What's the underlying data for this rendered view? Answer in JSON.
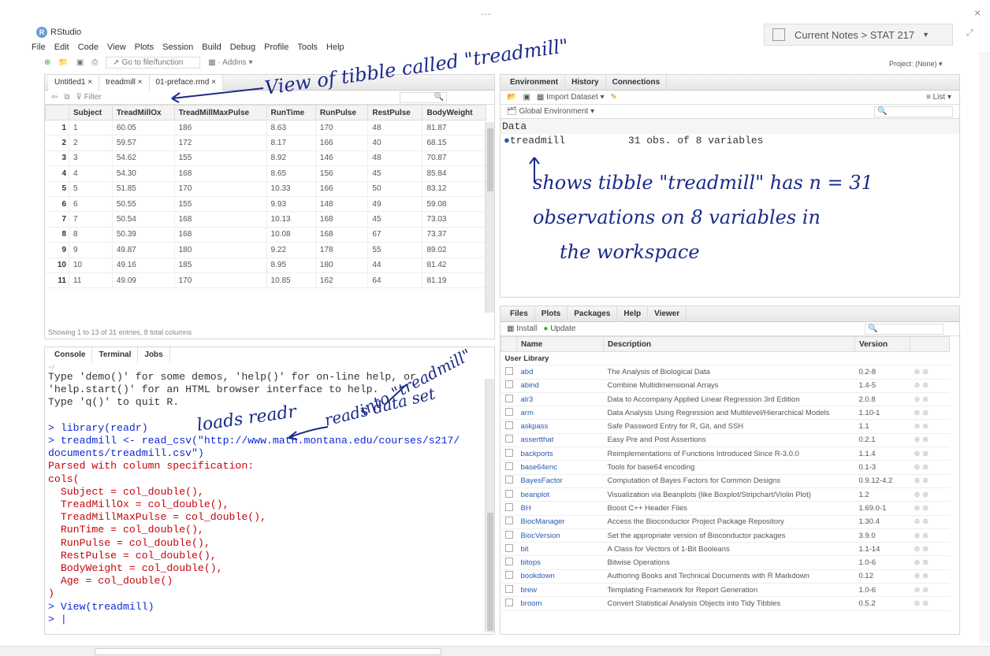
{
  "window": {
    "dots": "···",
    "close": "×",
    "title": "RStudio"
  },
  "menu": [
    "File",
    "Edit",
    "Code",
    "View",
    "Plots",
    "Session",
    "Build",
    "Debug",
    "Profile",
    "Tools",
    "Help"
  ],
  "notes": {
    "text": "Current Notes > STAT 217"
  },
  "toolbar": {
    "goto": "Go to file/function",
    "addins": "Addins",
    "project": "Project: (None)"
  },
  "source": {
    "tabs": [
      "Untitled1",
      "treadmill",
      "01-preface.rmd"
    ],
    "filter": "Filter",
    "columns": [
      "",
      "Subject",
      "TreadMillOx",
      "TreadMillMaxPulse",
      "RunTime",
      "RunPulse",
      "RestPulse",
      "BodyWeight"
    ],
    "rows": [
      [
        "1",
        "1",
        "60.05",
        "186",
        "8.63",
        "170",
        "48",
        "81.87"
      ],
      [
        "2",
        "2",
        "59.57",
        "172",
        "8.17",
        "166",
        "40",
        "68.15"
      ],
      [
        "3",
        "3",
        "54.62",
        "155",
        "8.92",
        "146",
        "48",
        "70.87"
      ],
      [
        "4",
        "4",
        "54.30",
        "168",
        "8.65",
        "156",
        "45",
        "85.84"
      ],
      [
        "5",
        "5",
        "51.85",
        "170",
        "10.33",
        "166",
        "50",
        "83.12"
      ],
      [
        "6",
        "6",
        "50.55",
        "155",
        "9.93",
        "148",
        "49",
        "59.08"
      ],
      [
        "7",
        "7",
        "50.54",
        "168",
        "10.13",
        "168",
        "45",
        "73.03"
      ],
      [
        "8",
        "8",
        "50.39",
        "168",
        "10.08",
        "168",
        "67",
        "73.37"
      ],
      [
        "9",
        "9",
        "49.87",
        "180",
        "9.22",
        "178",
        "55",
        "89.02"
      ],
      [
        "10",
        "10",
        "49.16",
        "185",
        "8.95",
        "180",
        "44",
        "81.42"
      ],
      [
        "11",
        "11",
        "49.09",
        "170",
        "10.85",
        "162",
        "64",
        "81.19"
      ]
    ],
    "status": "Showing 1 to 13 of 31 entries, 8 total columns"
  },
  "console": {
    "tabs": [
      "Console",
      "Terminal",
      "Jobs"
    ],
    "path": "~/",
    "lines": [
      {
        "t": "Type 'demo()' for some demos, 'help()' for on-line help, or",
        "c": ""
      },
      {
        "t": "'help.start()' for an HTML browser interface to help.",
        "c": ""
      },
      {
        "t": "Type 'q()' to quit R.",
        "c": ""
      },
      {
        "t": " ",
        "c": ""
      },
      {
        "t": "> library(readr)",
        "c": "blue"
      },
      {
        "t": "> treadmill <- read_csv(\"http://www.math.montana.edu/courses/s217/",
        "c": "blue"
      },
      {
        "t": "documents/treadmill.csv\")",
        "c": "blue"
      },
      {
        "t": "Parsed with column specification:",
        "c": "red"
      },
      {
        "t": "cols(",
        "c": "red"
      },
      {
        "t": "  Subject = col_double(),",
        "c": "red"
      },
      {
        "t": "  TreadMillOx = col_double(),",
        "c": "red"
      },
      {
        "t": "  TreadMillMaxPulse = col_double(),",
        "c": "red"
      },
      {
        "t": "  RunTime = col_double(),",
        "c": "red"
      },
      {
        "t": "  RunPulse = col_double(),",
        "c": "red"
      },
      {
        "t": "  RestPulse = col_double(),",
        "c": "red"
      },
      {
        "t": "  BodyWeight = col_double(),",
        "c": "red"
      },
      {
        "t": "  Age = col_double()",
        "c": "red"
      },
      {
        "t": ")",
        "c": "red"
      },
      {
        "t": "> View(treadmill)",
        "c": "blue"
      },
      {
        "t": "> |",
        "c": "blue"
      }
    ]
  },
  "env": {
    "tabs": [
      "Environment",
      "History",
      "Connections"
    ],
    "import": "Import Dataset",
    "list": "List",
    "global": "Global Environment",
    "section": "Data",
    "name": "treadmill",
    "desc": "31 obs. of 8 variables"
  },
  "files": {
    "tabs": [
      "Files",
      "Plots",
      "Packages",
      "Help",
      "Viewer"
    ],
    "install": "Install",
    "update": "Update",
    "cols": [
      "Name",
      "Description",
      "Version"
    ],
    "section": "User Library",
    "pkgs": [
      [
        "abd",
        "The Analysis of Biological Data",
        "0.2-8"
      ],
      [
        "abind",
        "Combine Multidimensional Arrays",
        "1.4-5"
      ],
      [
        "alr3",
        "Data to Accompany Applied Linear Regression 3rd Edition",
        "2.0.8"
      ],
      [
        "arm",
        "Data Analysis Using Regression and Multilevel/Hierarchical Models",
        "1.10-1"
      ],
      [
        "askpass",
        "Safe Password Entry for R, Git, and SSH",
        "1.1"
      ],
      [
        "assertthat",
        "Easy Pre and Post Assertions",
        "0.2.1"
      ],
      [
        "backports",
        "Reimplementations of Functions Introduced Since R-3.0.0",
        "1.1.4"
      ],
      [
        "base64enc",
        "Tools for base64 encoding",
        "0.1-3"
      ],
      [
        "BayesFactor",
        "Computation of Bayes Factors for Common Designs",
        "0.9.12-4.2"
      ],
      [
        "beanplot",
        "Visualization via Beanplots (like Boxplot/Stripchart/Violin Plot)",
        "1.2"
      ],
      [
        "BH",
        "Boost C++ Header Files",
        "1.69.0-1"
      ],
      [
        "BiocManager",
        "Access the Bioconductor Project Package Repository",
        "1.30.4"
      ],
      [
        "BiocVersion",
        "Set the appropriate version of Bioconductor packages",
        "3.9.0"
      ],
      [
        "bit",
        "A Class for Vectors of 1-Bit Booleans",
        "1.1-14"
      ],
      [
        "bitops",
        "Bitwise Operations",
        "1.0-6"
      ],
      [
        "bookdown",
        "Authoring Books and Technical Documents with R Markdown",
        "0.12"
      ],
      [
        "brew",
        "Templating Framework for Report Generation",
        "1.0-6"
      ],
      [
        "broom",
        "Convert Statistical Analysis Objects into Tidy Tibbles",
        "0.5.2"
      ]
    ]
  },
  "annotations": {
    "view": "View of tibble called \"treadmill\"",
    "shows1": "shows tibble \"treadmill\" has  n = 31",
    "shows2": "observations on 8 variables in",
    "shows3": "the workspace",
    "loads": "loads readr",
    "reads1": "reads data set",
    "reads2": "into \"treadmill\""
  }
}
